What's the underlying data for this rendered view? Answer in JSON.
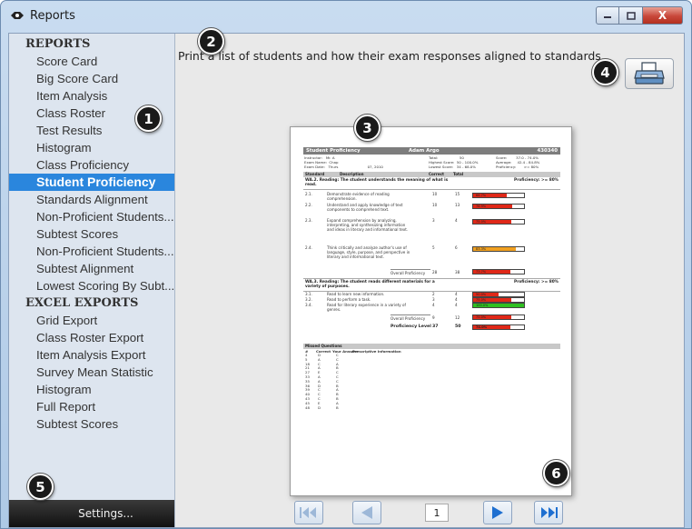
{
  "window": {
    "title": "Reports",
    "minimize_label": "—",
    "maximize_label": "□",
    "close_label": "X"
  },
  "sidebar": {
    "sections": [
      {
        "heading": "REPORTS",
        "items": [
          "Score Card",
          "Big Score Card",
          "Item Analysis",
          "Class Roster",
          "Test Results",
          "Histogram",
          "Class Proficiency",
          "Student Proficiency",
          "Standards Alignment",
          "Non-Proficient Students...",
          "Subtest Scores",
          "Non-Proficient Students...",
          "Subtest Alignment",
          "Lowest Scoring By Subt..."
        ]
      },
      {
        "heading": "EXCEL EXPORTS",
        "items": [
          "Grid Export",
          "Class Roster Export",
          "Item Analysis Export",
          "Survey Mean Statistic",
          "Histogram",
          "Full Report",
          "Subtest Scores"
        ]
      }
    ],
    "selected_item": "Student Proficiency",
    "settings_label": "Settings..."
  },
  "main": {
    "description": "Print a list of students and how their exam responses aligned to standards.",
    "print_button_icon": "printer-icon"
  },
  "report": {
    "title": "Student Proficiency",
    "student_name": "Adam Argo",
    "student_id": "430340",
    "meta": {
      "col1": "Instructor:   Mr. A\nExam Name:  Chap\nExam Date:   Thurs                          07, 2010",
      "col2": "Total:                   50\nHighest Score:  50 - 100.0%\nLowest Score:   34 - 68.0%",
      "col3": "Score:        37.0 - 74.0%\nAverage:     42.4 - 84.8%\nProficiency:       >= 80%"
    },
    "columns": {
      "standard": "Standard",
      "description": "Description",
      "correct": "Correct",
      "total": "Total"
    },
    "sections": [
      {
        "heading": "WA.2. Reading: The student understands the meaning of what is read.",
        "proficiency": "Proficiency: >= 80%",
        "rows": [
          {
            "standard": "2.1.",
            "description": "Demonstrate evidence of reading comprehension.",
            "correct": "10",
            "total": "15",
            "percent": "66.7%"
          },
          {
            "standard": "2.2.",
            "description": "Understand and apply knowledge of text components to comprehend text.",
            "correct": "10",
            "total": "13",
            "percent": "76.9%"
          },
          {
            "standard": "2.3.",
            "description": "Expand comprehension by analyzing, interpreting, and synthesizing information and ideas in literary and informational text.",
            "correct": "3",
            "total": "4",
            "percent": "75.0%"
          },
          {
            "standard": "2.4.",
            "description": "Think critically and analyze author's use of language, style, purpose, and perspective in literary and informational text.",
            "correct": "5",
            "total": "6",
            "percent": "83.3%"
          }
        ],
        "overall_label": "Overall Proficiency",
        "overall_correct": "28",
        "overall_total": "38",
        "overall_percent": "73.7%"
      },
      {
        "heading": "WA.3. Reading: The student reads different materials for a variety of purposes.",
        "proficiency": "Proficiency: >= 80%",
        "rows": [
          {
            "standard": "3.1.",
            "description": "Read to learn new information.",
            "correct": "2",
            "total": "4",
            "percent": "50.0%"
          },
          {
            "standard": "3.2.",
            "description": "Read to perform a task.",
            "correct": "3",
            "total": "4",
            "percent": "75.0%"
          },
          {
            "standard": "3.4.",
            "description": "Read for literary experience in a variety of genres.",
            "correct": "4",
            "total": "4",
            "percent": "100.0%"
          }
        ],
        "overall_label": "Overall Proficiency",
        "overall_correct": "9",
        "overall_total": "12",
        "overall_percent": "75.0%"
      }
    ],
    "proficiency_level": {
      "label": "Proficiency Level",
      "correct": "37",
      "total": "50",
      "percent": "74.0%"
    },
    "missed": {
      "heading": "Missed Questions",
      "col_num": "#",
      "col_correct": "Correct",
      "col_answer": "Your Answer",
      "col_info": "Prescriptive Information",
      "rows": [
        [
          "4",
          "D",
          "C"
        ],
        [
          "5",
          "A",
          "C"
        ],
        [
          "18",
          "C",
          "A"
        ],
        [
          "21",
          "A",
          "B"
        ],
        [
          "27",
          "E",
          "C"
        ],
        [
          "33",
          "A",
          "C"
        ],
        [
          "35",
          "A",
          "C"
        ],
        [
          "36",
          "D",
          "B"
        ],
        [
          "39",
          "C",
          "A"
        ],
        [
          "40",
          "C",
          "B"
        ],
        [
          "43",
          "C",
          "B"
        ],
        [
          "45",
          "E",
          "A"
        ],
        [
          "48",
          "D",
          "B"
        ]
      ]
    }
  },
  "pager": {
    "page": "1",
    "first_icon": "skip-first-icon",
    "prev_icon": "prev-page-icon",
    "next_icon": "next-page-icon",
    "last_icon": "skip-last-icon"
  },
  "callouts": [
    "1",
    "2",
    "3",
    "4",
    "5",
    "6"
  ],
  "colors": {
    "selected_bg": "#2a86dd",
    "bar_red": "#e02818",
    "bar_orange": "#f0a020",
    "bar_green": "#2ec020",
    "callout_bg": "#1a1a1a"
  }
}
